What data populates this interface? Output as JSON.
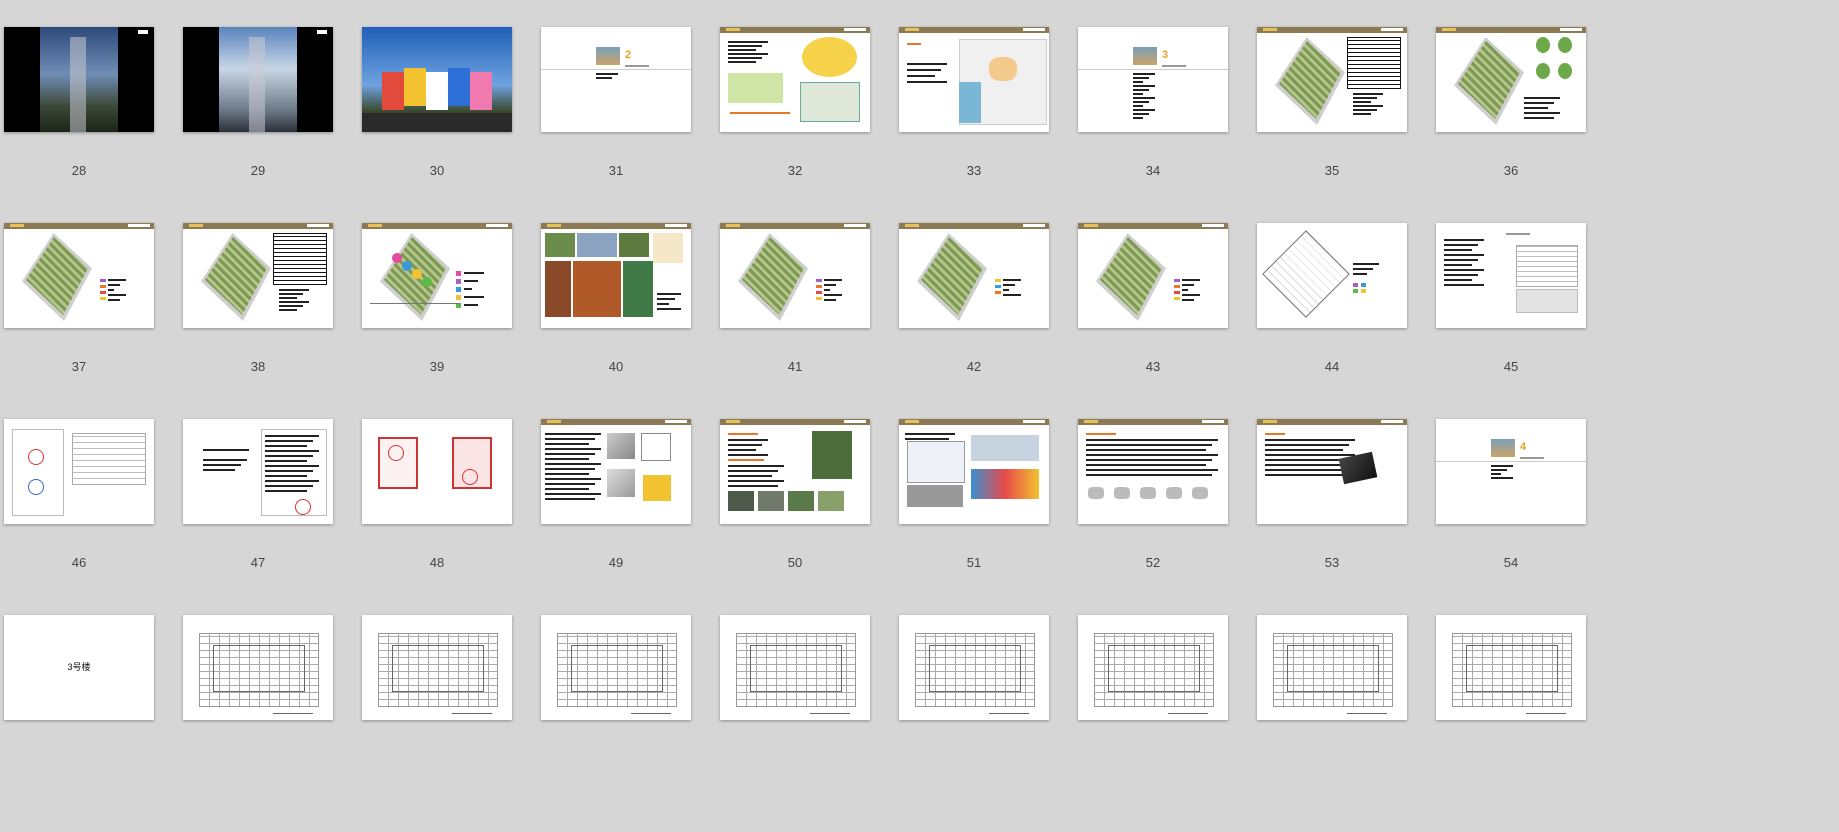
{
  "slides": [
    {
      "number": "28",
      "kind": "photo-tower-night"
    },
    {
      "number": "29",
      "kind": "photo-tower-day"
    },
    {
      "number": "30",
      "kind": "photo-colorful-building"
    },
    {
      "number": "31",
      "kind": "section-cover-2"
    },
    {
      "number": "32",
      "kind": "maps-collage"
    },
    {
      "number": "33",
      "kind": "site-map"
    },
    {
      "number": "34",
      "kind": "section-cover-3"
    },
    {
      "number": "35",
      "kind": "site-plan-table"
    },
    {
      "number": "36",
      "kind": "site-plan-icons"
    },
    {
      "number": "37",
      "kind": "site-plan-legend"
    },
    {
      "number": "38",
      "kind": "site-plan-table"
    },
    {
      "number": "39",
      "kind": "site-plan-colored"
    },
    {
      "number": "40",
      "kind": "photo-collage"
    },
    {
      "number": "41",
      "kind": "site-plan-legend"
    },
    {
      "number": "42",
      "kind": "site-plan-highlight"
    },
    {
      "number": "43",
      "kind": "site-plan-legend"
    },
    {
      "number": "44",
      "kind": "outline-plan"
    },
    {
      "number": "45",
      "kind": "text-table"
    },
    {
      "number": "46",
      "kind": "document-stamps"
    },
    {
      "number": "47",
      "kind": "document-text"
    },
    {
      "number": "48",
      "kind": "certificates"
    },
    {
      "number": "49",
      "kind": "text-with-images"
    },
    {
      "number": "50",
      "kind": "text-with-photos"
    },
    {
      "number": "51",
      "kind": "product-images"
    },
    {
      "number": "52",
      "kind": "text-with-devices"
    },
    {
      "number": "53",
      "kind": "text-with-device"
    },
    {
      "number": "54",
      "kind": "section-cover-4"
    },
    {
      "number": "",
      "kind": "label-slide",
      "label": "3号楼"
    },
    {
      "number": "",
      "kind": "floor-plan"
    },
    {
      "number": "",
      "kind": "floor-plan"
    },
    {
      "number": "",
      "kind": "floor-plan"
    },
    {
      "number": "",
      "kind": "floor-plan"
    },
    {
      "number": "",
      "kind": "floor-plan"
    },
    {
      "number": "",
      "kind": "floor-plan"
    },
    {
      "number": "",
      "kind": "floor-plan"
    },
    {
      "number": "",
      "kind": "floor-plan"
    }
  ],
  "cover_numbers": {
    "s31": "2",
    "s34": "3",
    "s54": "4"
  },
  "colors": {
    "background": "#d6d6d6",
    "header_bar": "#8c7a55",
    "accent": "#e8a020"
  }
}
